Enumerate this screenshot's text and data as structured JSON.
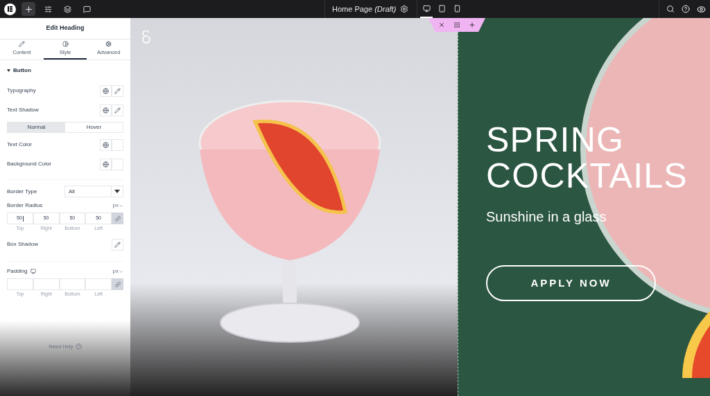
{
  "topbar": {
    "page_title": "Home Page",
    "page_status": "(Draft)",
    "devices": [
      {
        "kind": "desktop",
        "selected": true
      },
      {
        "kind": "tablet",
        "selected": false
      },
      {
        "kind": "mobile",
        "selected": false
      }
    ]
  },
  "panel": {
    "title": "Edit Heading",
    "tabs": [
      {
        "label": "Content",
        "selected": false
      },
      {
        "label": "Style",
        "selected": true
      },
      {
        "label": "Advanced",
        "selected": false
      }
    ],
    "section": {
      "label": "Button",
      "expanded": true
    },
    "controls": [
      {
        "kind": "globe-edit",
        "label": "Typography"
      },
      {
        "kind": "globe-edit",
        "label": "Text Shadow"
      },
      {
        "kind": "states",
        "options": [
          {
            "label": "Normal",
            "selected": true
          },
          {
            "label": "Hover",
            "selected": false
          }
        ]
      },
      {
        "kind": "color",
        "label": "Text Color"
      },
      {
        "kind": "color",
        "label": "Background Color"
      },
      {
        "kind": "select",
        "label": "Border Type",
        "value": "All"
      },
      {
        "kind": "dimensions",
        "label": "Border Radius",
        "unit": "px",
        "responsive": false,
        "fields": [
          {
            "value": "50",
            "focused": true,
            "label": "Top"
          },
          {
            "value": "50",
            "focused": false,
            "label": "Right"
          },
          {
            "value": "50",
            "focused": false,
            "label": "Bottom"
          },
          {
            "value": "50",
            "focused": false,
            "label": "Left"
          }
        ]
      },
      {
        "kind": "edit",
        "label": "Box Shadow"
      },
      {
        "kind": "dimensions",
        "label": "Padding",
        "unit": "px",
        "responsive": true,
        "fields": [
          {
            "focused": false,
            "label": "Top"
          },
          {
            "focused": false,
            "label": "Right"
          },
          {
            "focused": false,
            "label": "Bottom"
          },
          {
            "focused": false,
            "label": "Left"
          }
        ]
      }
    ],
    "help": "Need Help"
  },
  "canvas": {
    "headline": [
      "SPRING",
      "COCKTAILS"
    ],
    "subtitle": "Sunshine in a glass",
    "button": "APPLY NOW"
  }
}
